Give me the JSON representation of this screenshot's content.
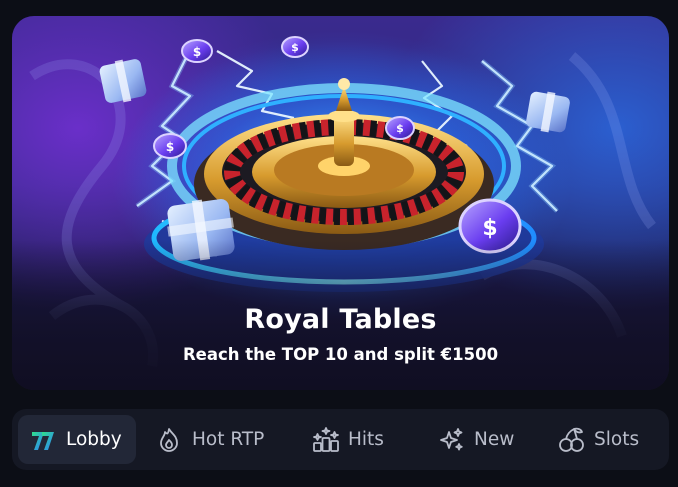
{
  "banner": {
    "title": "Royal Tables",
    "subtitle": "Reach the TOP 10 and split €1500"
  },
  "nav": {
    "items": [
      {
        "label": "Lobby",
        "icon": "lobby-logo-icon",
        "active": true
      },
      {
        "label": "Hot RTP",
        "icon": "flame-icon",
        "active": false
      },
      {
        "label": "Hits",
        "icon": "hits-chart-icon",
        "active": false
      },
      {
        "label": "New",
        "icon": "sparkles-icon",
        "active": false
      },
      {
        "label": "Slots",
        "icon": "cherries-icon",
        "active": false
      }
    ]
  },
  "colors": {
    "page_background": "#0c0e16",
    "nav_background": "#151824",
    "nav_active_background": "#222737",
    "nav_text": "#b9bdca",
    "accent_green": "#2fe08a",
    "accent_blue": "#2d7dff"
  }
}
